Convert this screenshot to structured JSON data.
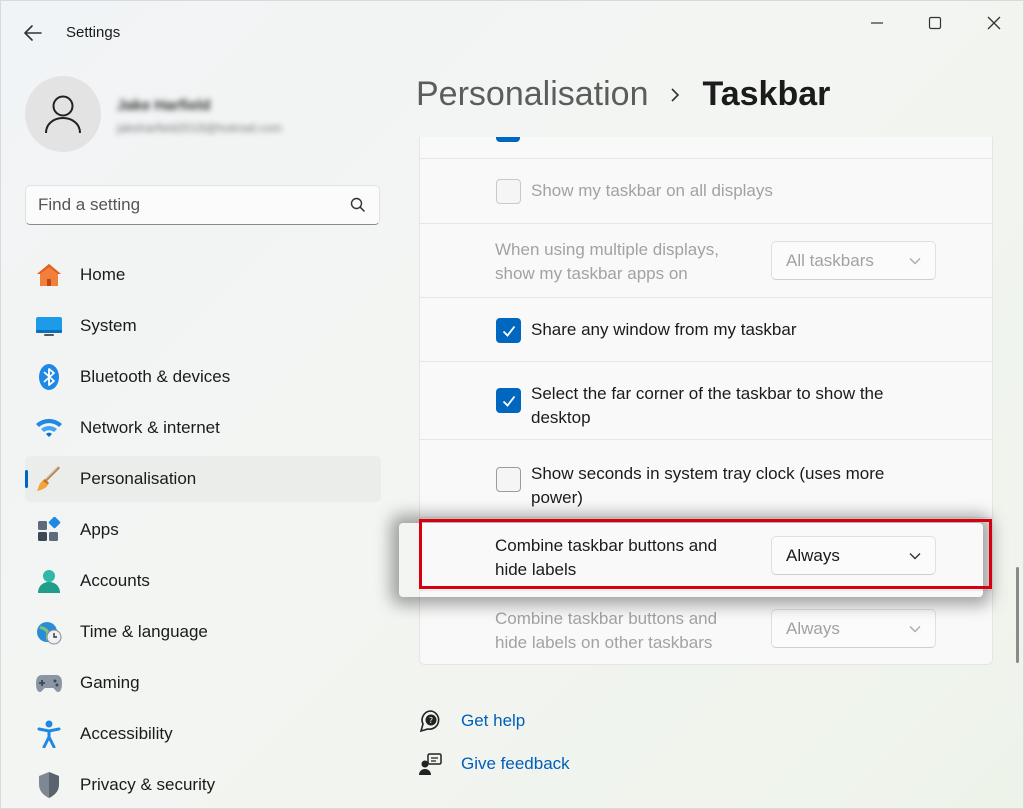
{
  "window": {
    "title": "Settings"
  },
  "profile": {
    "name": "Jake Harfield",
    "email": "jakeharfield2019@hotmail.com"
  },
  "search": {
    "placeholder": "Find a setting"
  },
  "nav": {
    "items": [
      {
        "label": "Home",
        "icon": "home-icon"
      },
      {
        "label": "System",
        "icon": "system-icon"
      },
      {
        "label": "Bluetooth & devices",
        "icon": "bluetooth-icon"
      },
      {
        "label": "Network & internet",
        "icon": "wifi-icon"
      },
      {
        "label": "Personalisation",
        "icon": "brush-icon",
        "selected": true
      },
      {
        "label": "Apps",
        "icon": "apps-icon"
      },
      {
        "label": "Accounts",
        "icon": "accounts-icon"
      },
      {
        "label": "Time & language",
        "icon": "clock-globe-icon"
      },
      {
        "label": "Gaming",
        "icon": "gamepad-icon"
      },
      {
        "label": "Accessibility",
        "icon": "accessibility-icon"
      },
      {
        "label": "Privacy & security",
        "icon": "shield-icon"
      }
    ]
  },
  "header": {
    "parent": "Personalisation",
    "current": "Taskbar"
  },
  "settings": {
    "show_on_all_displays": {
      "label": "Show my taskbar on all displays",
      "checked": false,
      "disabled": true
    },
    "multi_display_apps": {
      "label_line1": "When using multiple displays,",
      "label_line2": "show my taskbar apps on",
      "value": "All taskbars",
      "disabled": true
    },
    "share_window": {
      "label": "Share any window from my taskbar",
      "checked": true
    },
    "far_corner": {
      "label_line1": "Select the far corner of the taskbar to show the",
      "label_line2": "desktop",
      "checked": true
    },
    "show_seconds": {
      "label_line1": "Show seconds in system tray clock (uses more",
      "label_line2": "power)",
      "checked": false
    },
    "combine_buttons": {
      "label_line1": "Combine taskbar buttons and",
      "label_line2": "hide labels",
      "value": "Always"
    },
    "combine_other": {
      "label_line1": "Combine taskbar buttons and",
      "label_line2": "hide labels on other taskbars",
      "value": "Always",
      "disabled": true
    }
  },
  "help": {
    "get_help": "Get help",
    "give_feedback": "Give feedback"
  },
  "colors": {
    "accent": "#0067c0",
    "highlight": "#d7000f",
    "link": "#005fb8"
  }
}
